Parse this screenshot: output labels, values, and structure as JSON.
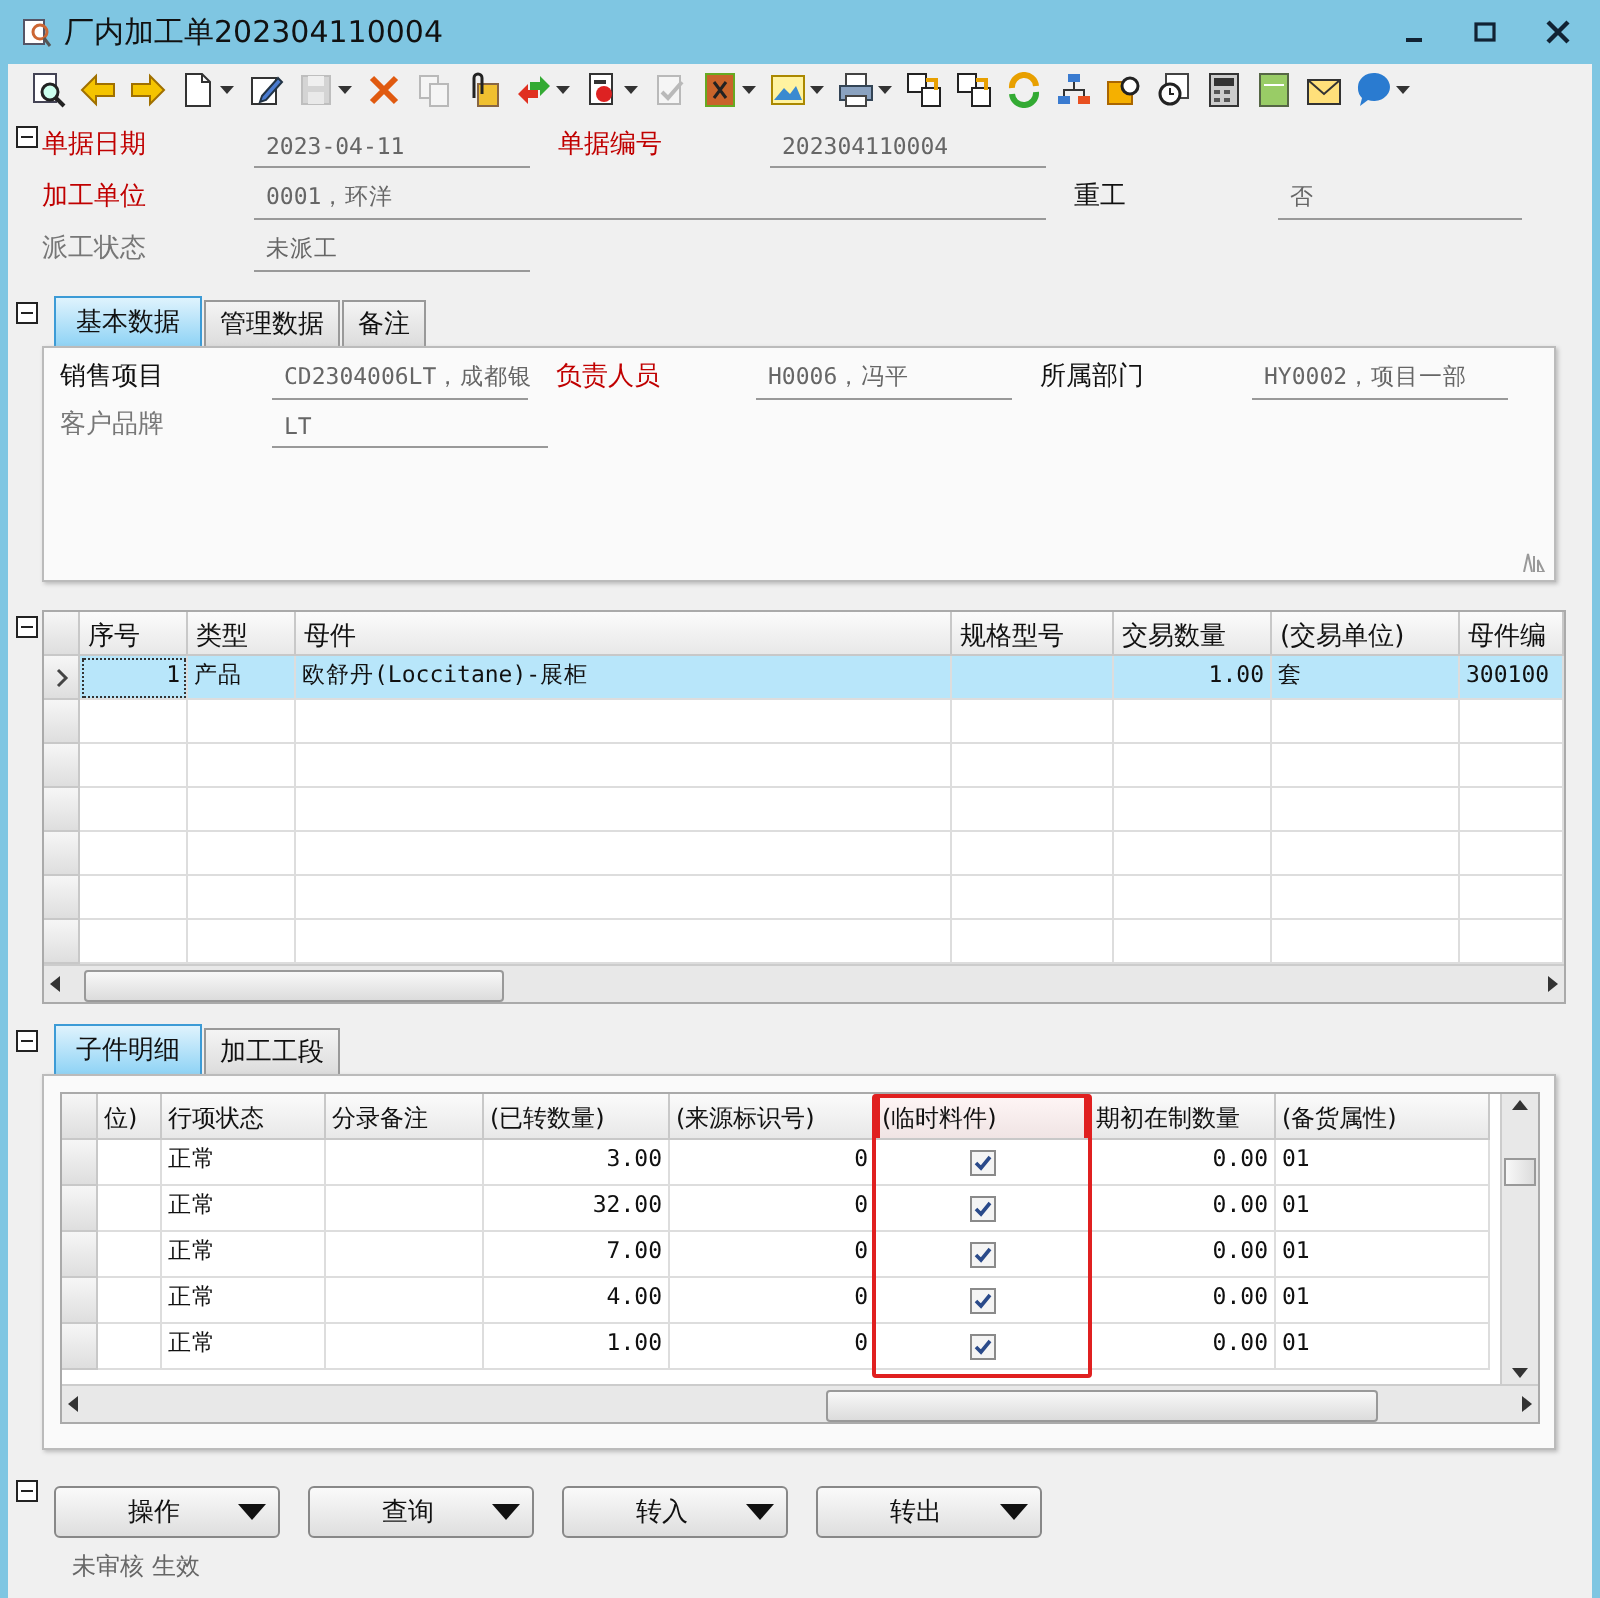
{
  "window": {
    "title": "厂内加工单202304110004"
  },
  "toolbar": [
    {
      "kind": "preview",
      "disabled": false,
      "dropdown": false
    },
    {
      "kind": "back",
      "disabled": false,
      "dropdown": false
    },
    {
      "kind": "forward",
      "disabled": false,
      "dropdown": false
    },
    {
      "kind": "new",
      "disabled": false,
      "dropdown": true
    },
    {
      "kind": "edit",
      "disabled": false,
      "dropdown": false
    },
    {
      "kind": "save",
      "disabled": true,
      "dropdown": true
    },
    {
      "kind": "delete",
      "disabled": false,
      "dropdown": false
    },
    {
      "kind": "copy",
      "disabled": true,
      "dropdown": false
    },
    {
      "kind": "attach",
      "disabled": false,
      "dropdown": false
    },
    {
      "kind": "transfer",
      "disabled": false,
      "dropdown": true
    },
    {
      "kind": "stamp",
      "disabled": false,
      "dropdown": true
    },
    {
      "kind": "approve",
      "disabled": true,
      "dropdown": false
    },
    {
      "kind": "export",
      "disabled": false,
      "dropdown": true
    },
    {
      "kind": "picture",
      "disabled": false,
      "dropdown": true
    },
    {
      "kind": "print",
      "disabled": false,
      "dropdown": true
    },
    {
      "kind": "link",
      "disabled": false,
      "dropdown": false
    },
    {
      "kind": "link",
      "disabled": false,
      "dropdown": false
    },
    {
      "kind": "refresh",
      "disabled": false,
      "dropdown": false
    },
    {
      "kind": "tree",
      "disabled": false,
      "dropdown": false
    },
    {
      "kind": "find",
      "disabled": false,
      "dropdown": false
    },
    {
      "kind": "clock",
      "disabled": false,
      "dropdown": false
    },
    {
      "kind": "calculator",
      "disabled": false,
      "dropdown": false
    },
    {
      "kind": "note",
      "disabled": false,
      "dropdown": false
    },
    {
      "kind": "mail",
      "disabled": false,
      "dropdown": false
    },
    {
      "kind": "chat",
      "disabled": false,
      "dropdown": true
    }
  ],
  "header": {
    "expanded": true,
    "rows": [
      [
        {
          "label": "单据日期",
          "kind": "required",
          "value": "2023-04-11"
        },
        {
          "label": "单据编号",
          "kind": "required",
          "value": "202304110004"
        }
      ],
      [
        {
          "label": "加工单位",
          "kind": "required",
          "value": "0001，环洋"
        },
        {
          "label": "重工",
          "kind": "normal",
          "value": "否"
        }
      ],
      [
        {
          "label": "派工状态",
          "kind": "readonly",
          "value": "未派工"
        }
      ]
    ]
  },
  "detail": {
    "expanded": true,
    "tabs": [
      {
        "label": "基本数据",
        "selected": true
      },
      {
        "label": "管理数据",
        "selected": false
      },
      {
        "label": "备注",
        "selected": false
      }
    ],
    "rows": [
      [
        {
          "label": "销售项目",
          "kind": "normal",
          "value": "CD2304006LT，成都银"
        },
        {
          "label": "负责人员",
          "kind": "required",
          "value": "H0006，冯平"
        },
        {
          "label": "所属部门",
          "kind": "normal",
          "value": "HY0002，项目一部"
        }
      ],
      [
        {
          "label": "客户品牌",
          "kind": "readonly",
          "value": "LT"
        }
      ]
    ]
  },
  "parent_grid": {
    "expanded": true,
    "columns": [
      {
        "label": "序号",
        "kind": "number"
      },
      {
        "label": "类型",
        "kind": "text"
      },
      {
        "label": "母件",
        "kind": "text"
      },
      {
        "label": "规格型号",
        "kind": "text"
      },
      {
        "label": "交易数量",
        "kind": "number"
      },
      {
        "label": "(交易单位)",
        "kind": "text"
      },
      {
        "label": "母件编",
        "kind": "text"
      }
    ],
    "rows": [
      {
        "selected": true,
        "cells": [
          "1",
          "产品",
          "欧舒丹(Loccitane)-展柜",
          null,
          "1.00",
          "套",
          "300100"
        ]
      }
    ]
  },
  "child_section": {
    "expanded": true,
    "tabs": [
      {
        "label": "子件明细",
        "selected": true
      },
      {
        "label": "加工工段",
        "selected": false
      }
    ],
    "columns": [
      {
        "label": "位)",
        "kind": "text",
        "highlighted": false
      },
      {
        "label": "行项状态",
        "kind": "text",
        "highlighted": false
      },
      {
        "label": "分录备注",
        "kind": "text",
        "highlighted": false
      },
      {
        "label": "(已转数量)",
        "kind": "number",
        "highlighted": false
      },
      {
        "label": "(来源标识号)",
        "kind": "number",
        "highlighted": false
      },
      {
        "label": "(临时料件)",
        "kind": "check",
        "highlighted": true
      },
      {
        "label": "期初在制数量",
        "kind": "number",
        "highlighted": false
      },
      {
        "label": "(备货属性)",
        "kind": "text",
        "highlighted": false
      }
    ],
    "rows": [
      {
        "cells": [
          null,
          "正常",
          null,
          "3.00",
          "0",
          true,
          "0.00",
          "01"
        ]
      },
      {
        "cells": [
          null,
          "正常",
          null,
          "32.00",
          "0",
          true,
          "0.00",
          "01"
        ]
      },
      {
        "cells": [
          null,
          "正常",
          null,
          "7.00",
          "0",
          true,
          "0.00",
          "01"
        ]
      },
      {
        "cells": [
          null,
          "正常",
          null,
          "4.00",
          "0",
          true,
          "0.00",
          "01"
        ]
      },
      {
        "cells": [
          null,
          "正常",
          null,
          "1.00",
          "0",
          true,
          "0.00",
          "01"
        ]
      }
    ]
  },
  "actions": {
    "expanded": true,
    "buttons": [
      {
        "label": "操作"
      },
      {
        "label": "查询"
      },
      {
        "label": "转入"
      },
      {
        "label": "转出"
      }
    ]
  },
  "status_bar": {
    "text": "未审核 生效"
  }
}
